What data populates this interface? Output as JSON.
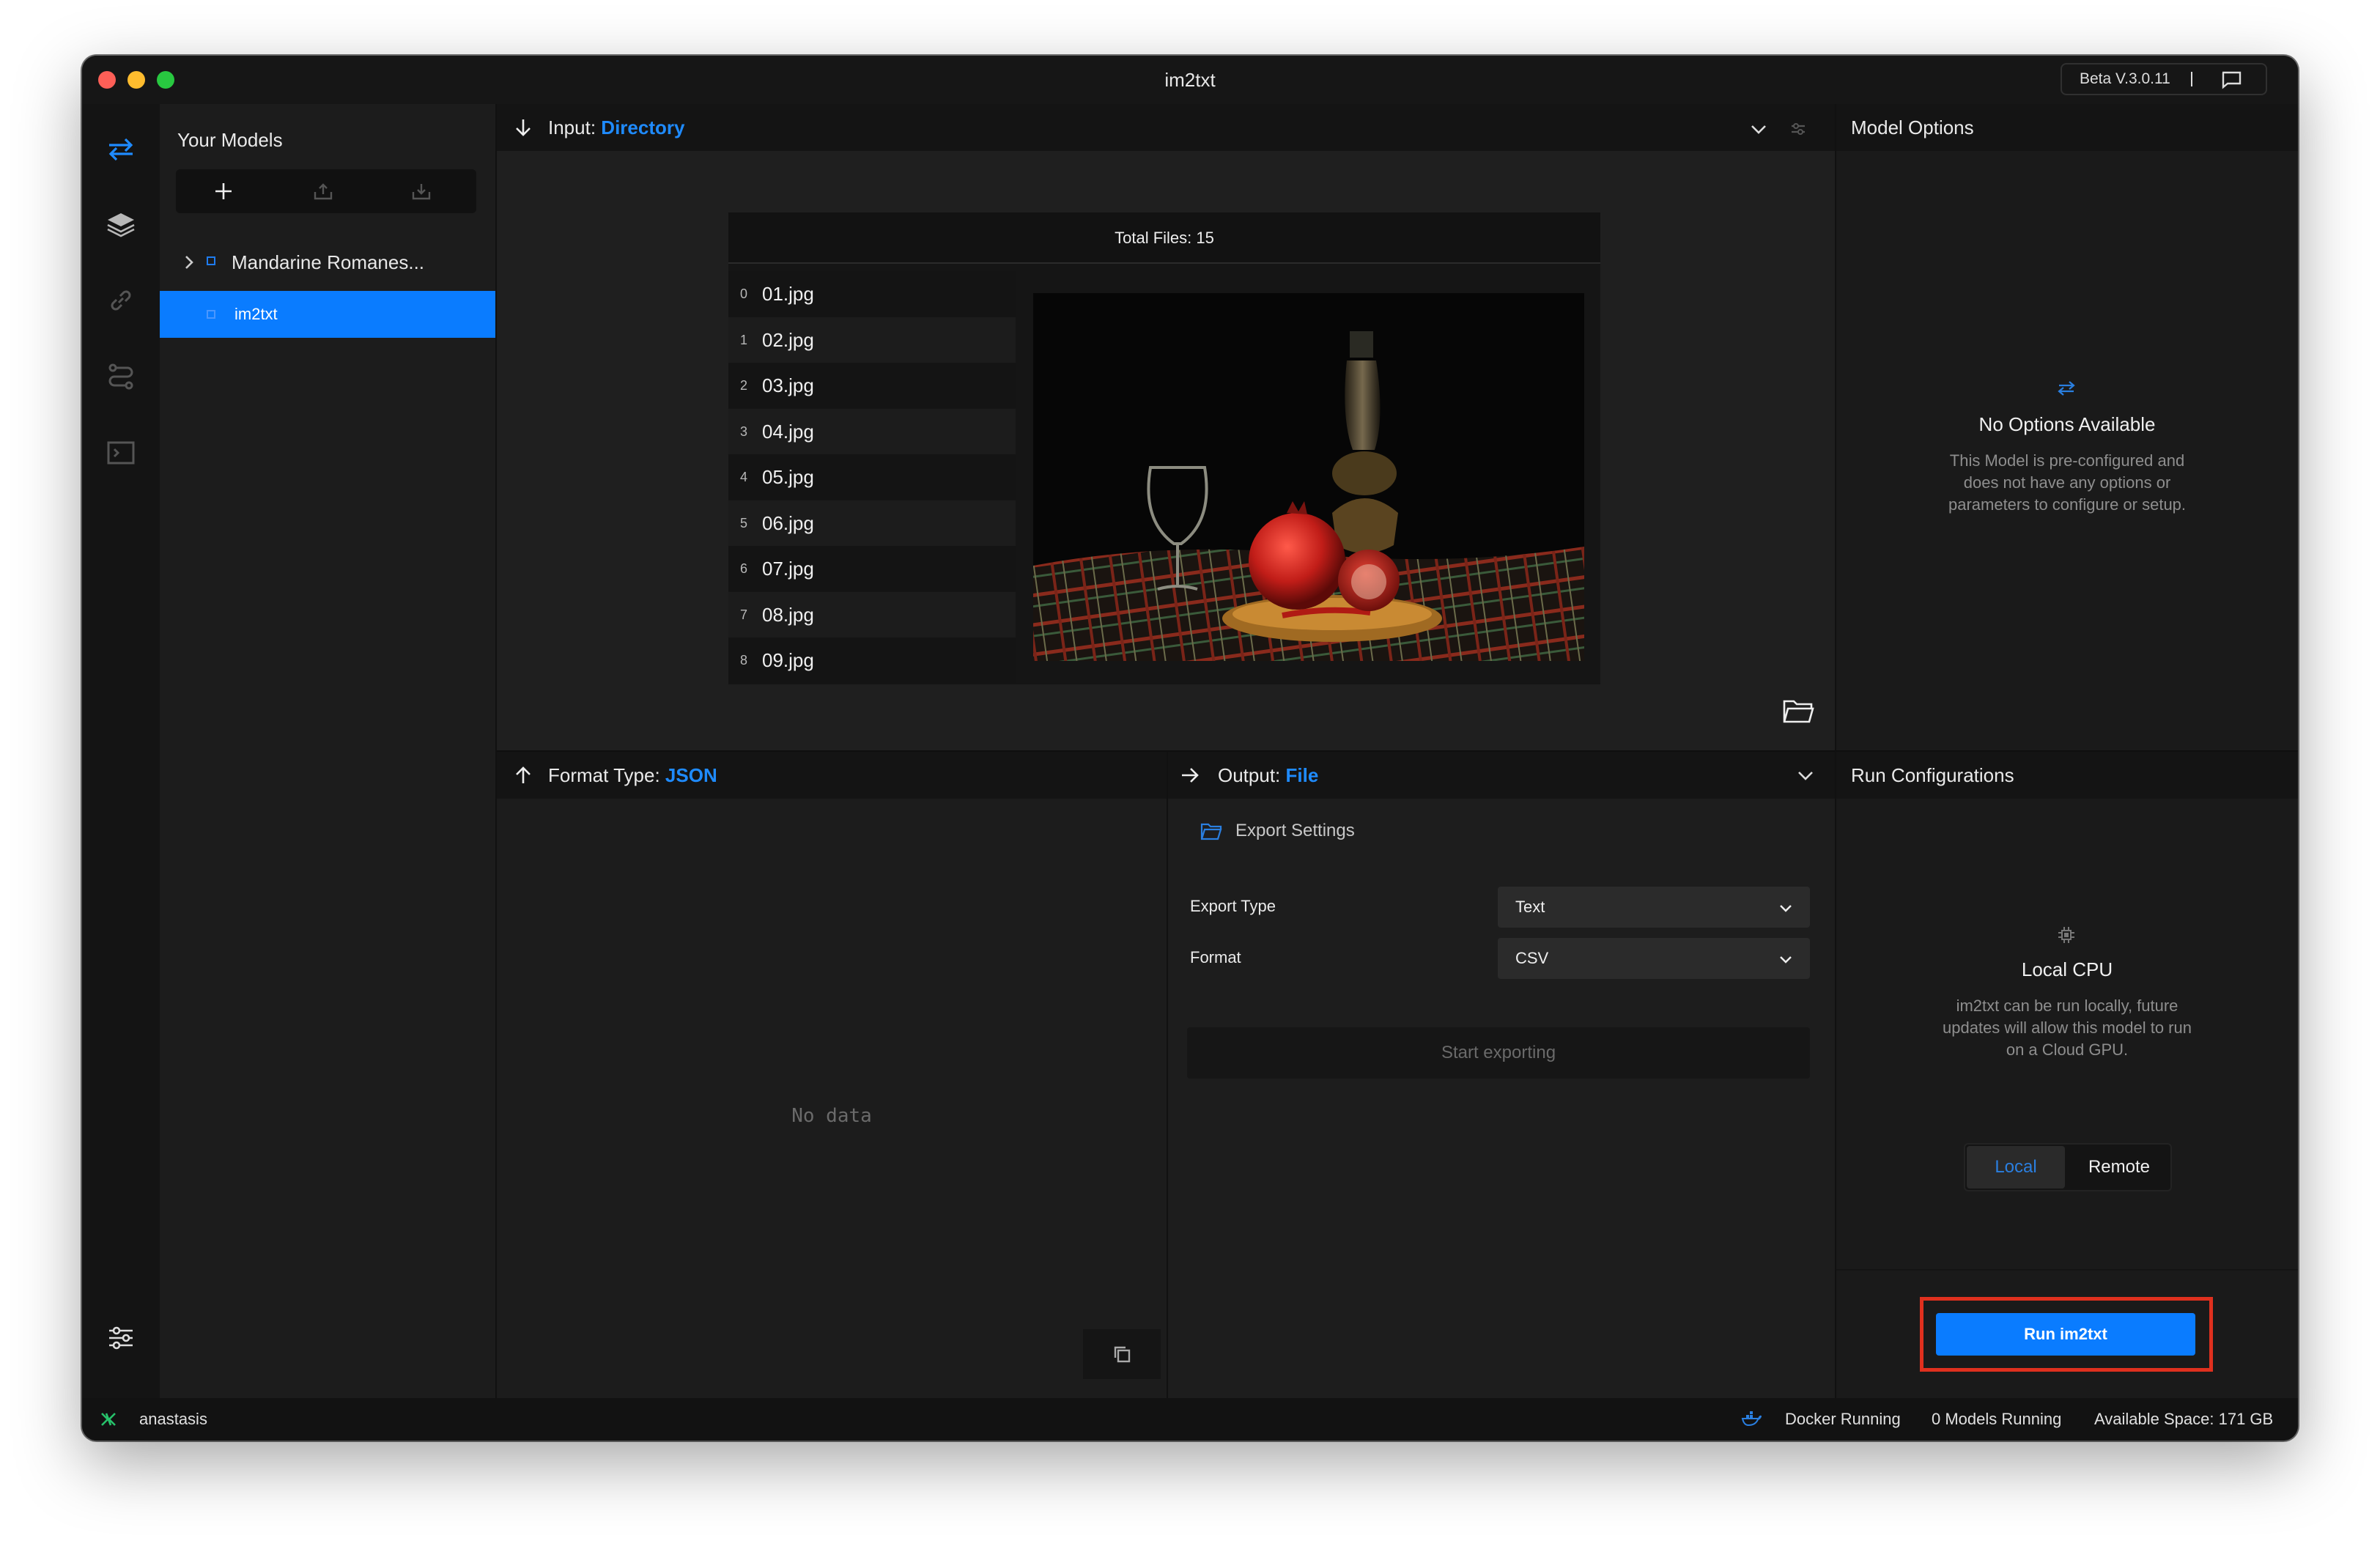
{
  "window": {
    "title": "im2txt",
    "version": "Beta V.3.0.11",
    "traffic_colors": [
      "#fe5f57",
      "#febc2e",
      "#28c840"
    ]
  },
  "rail": {
    "icons": [
      "swap-arrows-icon",
      "layers-icon",
      "link-icon",
      "route-icon",
      "terminal-icon",
      "sliders-icon"
    ],
    "active_color": "#1f8bff"
  },
  "models": {
    "title": "Your Models",
    "toolbar": [
      "add-icon",
      "upload-icon",
      "download-icon"
    ],
    "group_label": "Mandarine Romanes...",
    "selected_label": "im2txt"
  },
  "input": {
    "label": "Input:",
    "value": "Directory",
    "total_files": "Total Files: 15",
    "files": [
      {
        "idx": "0",
        "name": "01.jpg"
      },
      {
        "idx": "1",
        "name": "02.jpg"
      },
      {
        "idx": "2",
        "name": "03.jpg"
      },
      {
        "idx": "3",
        "name": "04.jpg"
      },
      {
        "idx": "4",
        "name": "05.jpg"
      },
      {
        "idx": "5",
        "name": "06.jpg"
      },
      {
        "idx": "6",
        "name": "07.jpg"
      },
      {
        "idx": "7",
        "name": "08.jpg"
      },
      {
        "idx": "8",
        "name": "09.jpg"
      }
    ]
  },
  "model_options": {
    "title": "Model Options",
    "empty_title": "No Options Available",
    "empty_text_lines": [
      "This Model is pre-configured and",
      "does not have any options or",
      "parameters to configure or setup."
    ]
  },
  "format": {
    "label": "Format Type:",
    "value": "JSON",
    "empty": "No data"
  },
  "output": {
    "label": "Output:",
    "value": "File",
    "export_settings": "Export Settings",
    "export_type_label": "Export Type",
    "export_type_value": "Text",
    "format_label": "Format",
    "format_value": "CSV",
    "start_button": "Start exporting"
  },
  "run_config": {
    "title": "Run Configurations",
    "mode_title": "Local CPU",
    "mode_text_lines": [
      "im2txt can be run locally, future",
      "updates will allow this model to run",
      "on a Cloud GPU."
    ],
    "local_label": "Local",
    "remote_label": "Remote",
    "run_button": "Run im2txt"
  },
  "status": {
    "user": "anastasis",
    "docker": "Docker Running",
    "models_running": "0 Models Running",
    "space": "Available Space: 171 GB"
  }
}
